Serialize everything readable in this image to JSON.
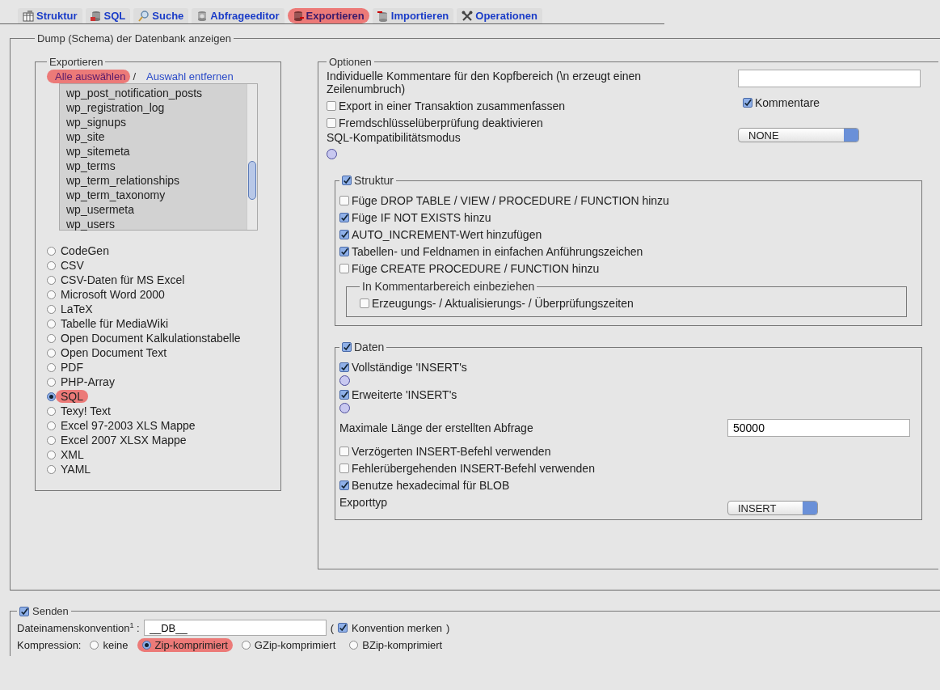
{
  "tabs": [
    {
      "label": "Struktur",
      "kind": "structure",
      "selected": false
    },
    {
      "label": "SQL",
      "kind": "sql",
      "selected": false
    },
    {
      "label": "Suche",
      "kind": "search",
      "selected": false
    },
    {
      "label": "Abfrageeditor",
      "kind": "query",
      "selected": false
    },
    {
      "label": "Exportieren",
      "kind": "export",
      "selected": true
    },
    {
      "label": "Importieren",
      "kind": "import",
      "selected": false
    },
    {
      "label": "Operationen",
      "kind": "operations",
      "selected": false
    }
  ],
  "dump": {
    "legend": "Dump (Schema) der Datenbank anzeigen",
    "export": {
      "legend": "Exportieren",
      "links": [
        {
          "label": "Alle auswählen",
          "highlighted": true
        },
        {
          "label": "Auswahl entfernen",
          "highlighted": false
        }
      ],
      "separator": "/",
      "tables": [
        "wp_post_notification_posts",
        "wp_registration_log",
        "wp_signups",
        "wp_site",
        "wp_sitemeta",
        "wp_terms",
        "wp_term_relationships",
        "wp_term_taxonomy",
        "wp_usermeta",
        "wp_users"
      ],
      "formats": [
        {
          "label": "CodeGen",
          "selected": false
        },
        {
          "label": "CSV",
          "selected": false
        },
        {
          "label": "CSV-Daten für MS Excel",
          "selected": false
        },
        {
          "label": "Microsoft Word 2000",
          "selected": false
        },
        {
          "label": "LaTeX",
          "selected": false
        },
        {
          "label": "Tabelle für MediaWiki",
          "selected": false
        },
        {
          "label": "Open Document Kalkulationstabelle",
          "selected": false
        },
        {
          "label": "Open Document Text",
          "selected": false
        },
        {
          "label": "PDF",
          "selected": false
        },
        {
          "label": "PHP-Array",
          "selected": false
        },
        {
          "label": "SQL",
          "selected": true
        },
        {
          "label": "Texy! Text",
          "selected": false
        },
        {
          "label": "Excel 97-2003 XLS Mappe",
          "selected": false
        },
        {
          "label": "Excel 2007 XLSX Mappe",
          "selected": false
        },
        {
          "label": "XML",
          "selected": false
        },
        {
          "label": "YAML",
          "selected": false
        }
      ]
    },
    "options": {
      "legend": "Optionen",
      "comment_label": "Individuelle Kommentare für den Kopfbereich (\\n erzeugt einen Zeilenumbruch)",
      "comments": {
        "label": "Kommentare",
        "checked": true
      },
      "checks": [
        {
          "label": "Export in einer Transaktion zusammenfassen",
          "checked": false
        },
        {
          "label": "Fremdschlüsselüberprüfung deaktivieren",
          "checked": false
        }
      ],
      "compat_label": "SQL-Kompatibilitätsmodus",
      "compat_value": "NONE",
      "structure": {
        "label": "Struktur",
        "checked": true,
        "items": [
          {
            "label": "Füge DROP TABLE / VIEW / PROCEDURE / FUNCTION hinzu",
            "checked": false
          },
          {
            "label": "Füge IF NOT EXISTS hinzu",
            "checked": true
          },
          {
            "label": "AUTO_INCREMENT-Wert hinzufügen",
            "checked": true
          },
          {
            "label": "Tabellen- und Feldnamen in einfachen Anführungszeichen",
            "checked": true
          },
          {
            "label": "Füge CREATE PROCEDURE / FUNCTION hinzu",
            "checked": false
          }
        ],
        "comment_group": {
          "legend": "In Kommentarbereich einbeziehen",
          "items": [
            {
              "label": "Erzeugungs- / Aktualisierungs- / Überprüfungszeiten",
              "checked": false
            }
          ]
        }
      },
      "data": {
        "label": "Daten",
        "checked": true,
        "rows": [
          {
            "kind": "checkbox",
            "label": "Vollständige 'INSERT's",
            "checked": true
          },
          {
            "kind": "help"
          },
          {
            "kind": "checkbox",
            "label": "Erweiterte 'INSERT's",
            "checked": true
          },
          {
            "kind": "help"
          },
          {
            "kind": "field",
            "label": "Maximale Länge der erstellten Abfrage",
            "value": "50000"
          },
          {
            "kind": "checkbox",
            "label": "Verzögerten INSERT-Befehl verwenden",
            "checked": false
          },
          {
            "kind": "checkbox",
            "label": "Fehlerübergehenden INSERT-Befehl verwenden",
            "checked": false
          },
          {
            "kind": "checkbox",
            "label": "Benutze hexadecimal für BLOB",
            "checked": true
          },
          {
            "kind": "select",
            "label": "Exporttyp",
            "value": "INSERT"
          }
        ]
      }
    }
  },
  "send": {
    "label": "Senden",
    "checked": true,
    "filename_label": "Dateinamenskonvention$^{1}$ :",
    "filename_value": "__DB__",
    "paren_open": "(",
    "remember": {
      "label": "Konvention merken",
      "checked": true
    },
    "paren_close": ")",
    "compression_label": "Kompression:",
    "compression": [
      {
        "label": "keine",
        "selected": false
      },
      {
        "label": "Zip-komprimiert",
        "selected": true
      },
      {
        "label": "GZip-komprimiert",
        "selected": false
      },
      {
        "label": "BZip-komprimiert",
        "selected": false
      }
    ]
  }
}
